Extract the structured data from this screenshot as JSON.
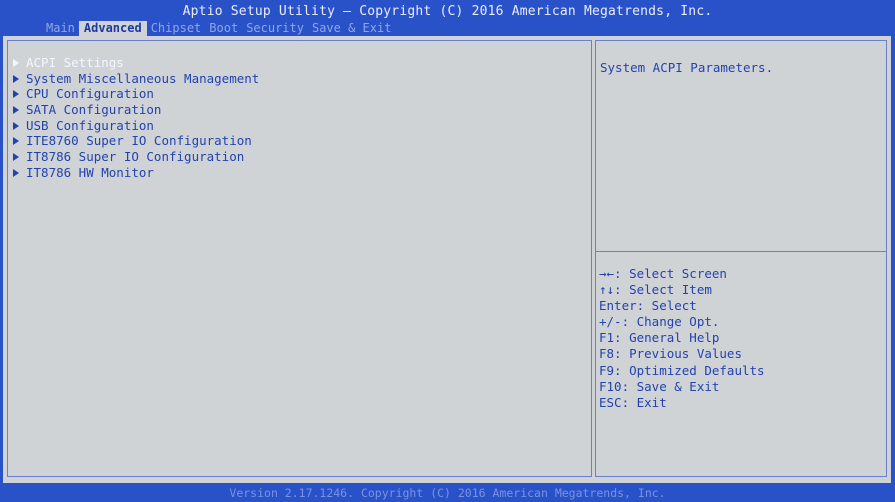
{
  "header": {
    "title": "Aptio Setup Utility – Copyright (C) 2016 American Megatrends, Inc.",
    "tabs": [
      {
        "label": "Main"
      },
      {
        "label": "Advanced"
      },
      {
        "label": "Chipset"
      },
      {
        "label": "Boot"
      },
      {
        "label": "Security"
      },
      {
        "label": "Save & Exit"
      }
    ],
    "active_tab": "Advanced"
  },
  "menu": {
    "items": [
      {
        "label": "ACPI Settings"
      },
      {
        "label": "System Miscellaneous Management"
      },
      {
        "label": "CPU Configuration"
      },
      {
        "label": "SATA Configuration"
      },
      {
        "label": "USB Configuration"
      },
      {
        "label": "ITE8760 Super IO Configuration"
      },
      {
        "label": "IT8786 Super IO Configuration"
      },
      {
        "label": "IT8786 HW Monitor"
      }
    ],
    "selected_item": "ACPI Settings"
  },
  "help": {
    "description": "System ACPI Parameters.",
    "keys": [
      {
        "text": "→←: Select Screen"
      },
      {
        "text": "↑↓: Select Item"
      },
      {
        "text": "Enter: Select"
      },
      {
        "text": "+/-: Change Opt."
      },
      {
        "text": "F1: General Help"
      },
      {
        "text": "F8: Previous Values"
      },
      {
        "text": "F9: Optimized Defaults"
      },
      {
        "text": "F10: Save & Exit"
      },
      {
        "text": "ESC: Exit"
      }
    ]
  },
  "footer": {
    "version": "Version 2.17.1246. Copyright (C) 2016 American Megatrends, Inc."
  },
  "colors": {
    "frame_blue": "#2a52c8",
    "panel_gray": "#cfd3d6",
    "text_blue": "#2342b0",
    "selected_text": "#f4f6ff"
  }
}
